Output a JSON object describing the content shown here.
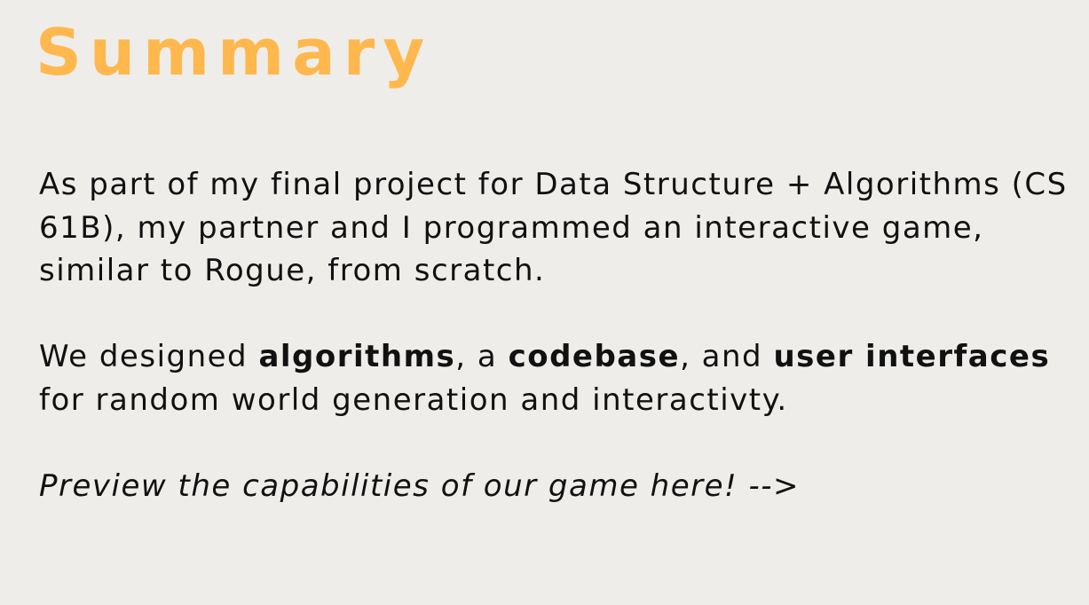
{
  "title": "Summary",
  "colors": {
    "background": "#eeedea",
    "title_accent": "#ffb84d",
    "body_text": "#111111"
  },
  "paragraph1": {
    "text": "As part of my final project for Data Structure + Algorithms (CS 61B), my partner and I programmed an interactive game, similar to Rogue, from scratch."
  },
  "paragraph2": {
    "intro": "We designed ",
    "bold1": "algorithms",
    "sep1": ", a ",
    "bold2": "codebase",
    "sep2": ", and ",
    "bold3": "user interfaces",
    "outro": " for random world generation and interactivty."
  },
  "preview": {
    "text": "Preview the capabilities of our game here! -->"
  }
}
